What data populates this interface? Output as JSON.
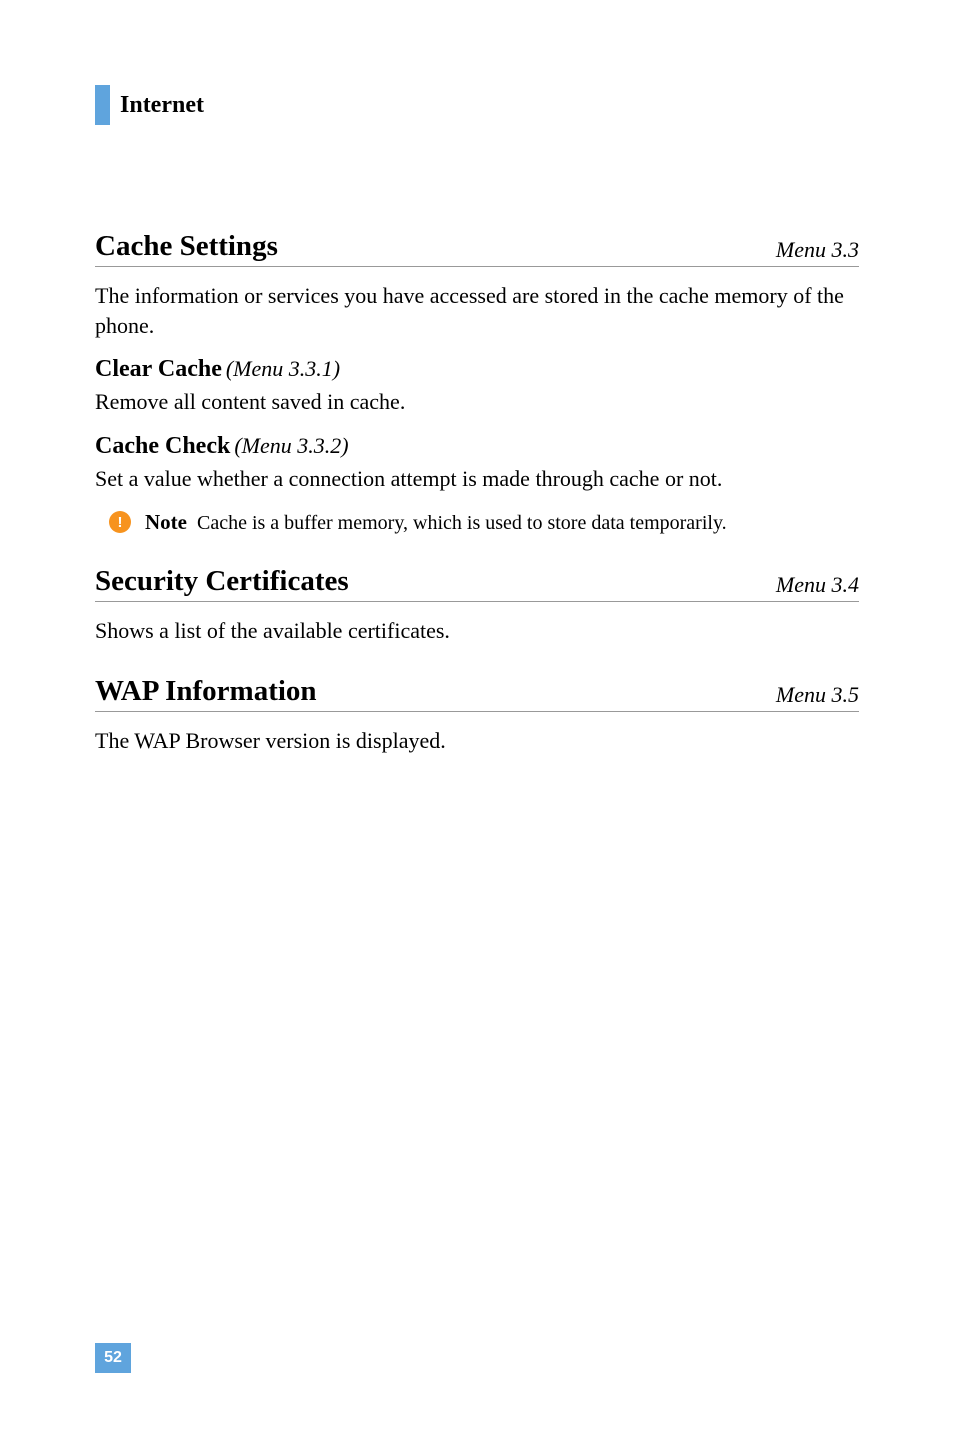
{
  "header": {
    "section_title": "Internet"
  },
  "sections": [
    {
      "title": "Cache Settings",
      "menu": "Menu 3.3",
      "intro": "The information or services you have accessed are stored in the cache memory of the phone.",
      "subsections": [
        {
          "heading": "Clear Cache",
          "ref": "(Menu 3.3.1)",
          "text": "Remove all content saved in cache."
        },
        {
          "heading": "Cache Check",
          "ref": "(Menu 3.3.2)",
          "text": "Set a value whether a connection attempt is made through cache or not."
        }
      ],
      "note": {
        "label": "Note",
        "text": "Cache is a buffer memory, which is used to store data temporarily."
      }
    },
    {
      "title": "Security Certificates",
      "menu": "Menu 3.4",
      "intro": "Shows a list of the available certificates."
    },
    {
      "title": "WAP Information",
      "menu": "Menu 3.5",
      "intro": "The WAP Browser version is displayed."
    }
  ],
  "page_number": "52",
  "note_icon_glyph": "!"
}
